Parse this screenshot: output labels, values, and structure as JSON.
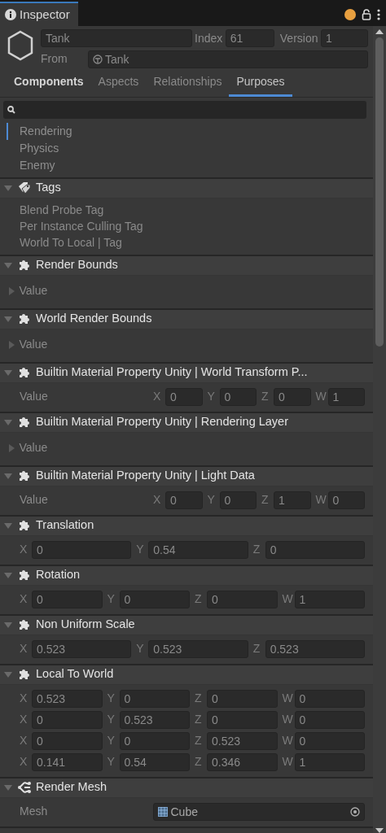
{
  "window": {
    "title": "Inspector"
  },
  "entity": {
    "name": "Tank",
    "index_label": "Index",
    "index": "61",
    "version_label": "Version",
    "version": "1",
    "from_label": "From",
    "from": "Tank"
  },
  "tabs": [
    {
      "label": "Components",
      "selected": false
    },
    {
      "label": "Aspects",
      "selected": false
    },
    {
      "label": "Relationships",
      "selected": false
    },
    {
      "label": "Purposes",
      "selected": true
    }
  ],
  "purposes": [
    {
      "label": "Rendering",
      "selected": true
    },
    {
      "label": "Physics",
      "selected": false
    },
    {
      "label": "Enemy",
      "selected": false
    }
  ],
  "components": [
    {
      "kind": "tags",
      "title": "Tags",
      "expanded": true,
      "items": [
        "Blend Probe Tag",
        "Per Instance Culling Tag",
        "World To Local | Tag"
      ]
    },
    {
      "kind": "foldout",
      "title": "Render Bounds",
      "expanded": true,
      "field": {
        "label": "Value",
        "expanded": false
      }
    },
    {
      "kind": "foldout",
      "title": "World Render Bounds",
      "expanded": true,
      "field": {
        "label": "Value",
        "expanded": false
      }
    },
    {
      "kind": "vector",
      "title": "Builtin Material Property Unity | World Transform P...",
      "expanded": true,
      "rows": [
        {
          "label": "Value",
          "fields": [
            {
              "axis": "X",
              "value": "0"
            },
            {
              "axis": "Y",
              "value": "0"
            },
            {
              "axis": "Z",
              "value": "0"
            },
            {
              "axis": "W",
              "value": "1"
            }
          ]
        }
      ]
    },
    {
      "kind": "foldout",
      "title": "Builtin Material Property Unity | Rendering Layer",
      "expanded": true,
      "field": {
        "label": "Value",
        "expanded": false
      }
    },
    {
      "kind": "vector",
      "title": "Builtin Material Property Unity | Light Data",
      "expanded": true,
      "rows": [
        {
          "label": "Value",
          "fields": [
            {
              "axis": "X",
              "value": "0"
            },
            {
              "axis": "Y",
              "value": "0"
            },
            {
              "axis": "Z",
              "value": "1"
            },
            {
              "axis": "W",
              "value": "0"
            }
          ]
        }
      ]
    },
    {
      "kind": "vector",
      "title": "Translation",
      "expanded": true,
      "rows": [
        {
          "fields": [
            {
              "axis": "X",
              "value": "0"
            },
            {
              "axis": "Y",
              "value": "0.54"
            },
            {
              "axis": "Z",
              "value": "0"
            }
          ]
        }
      ]
    },
    {
      "kind": "vector",
      "title": "Rotation",
      "expanded": true,
      "rows": [
        {
          "fields": [
            {
              "axis": "X",
              "value": "0"
            },
            {
              "axis": "Y",
              "value": "0"
            },
            {
              "axis": "Z",
              "value": "0"
            },
            {
              "axis": "W",
              "value": "1"
            }
          ]
        }
      ]
    },
    {
      "kind": "vector",
      "title": "Non Uniform Scale",
      "expanded": true,
      "rows": [
        {
          "fields": [
            {
              "axis": "X",
              "value": "0.523"
            },
            {
              "axis": "Y",
              "value": "0.523"
            },
            {
              "axis": "Z",
              "value": "0.523"
            }
          ]
        }
      ]
    },
    {
      "kind": "vector",
      "title": "Local To World",
      "expanded": true,
      "rows": [
        {
          "fields": [
            {
              "axis": "X",
              "value": "0.523"
            },
            {
              "axis": "Y",
              "value": "0"
            },
            {
              "axis": "Z",
              "value": "0"
            },
            {
              "axis": "W",
              "value": "0"
            }
          ]
        },
        {
          "fields": [
            {
              "axis": "X",
              "value": "0"
            },
            {
              "axis": "Y",
              "value": "0.523"
            },
            {
              "axis": "Z",
              "value": "0"
            },
            {
              "axis": "W",
              "value": "0"
            }
          ]
        },
        {
          "fields": [
            {
              "axis": "X",
              "value": "0"
            },
            {
              "axis": "Y",
              "value": "0"
            },
            {
              "axis": "Z",
              "value": "0.523"
            },
            {
              "axis": "W",
              "value": "0"
            }
          ]
        },
        {
          "fields": [
            {
              "axis": "X",
              "value": "0.141"
            },
            {
              "axis": "Y",
              "value": "0.54"
            },
            {
              "axis": "Z",
              "value": "0.346"
            },
            {
              "axis": "W",
              "value": "1"
            }
          ]
        }
      ]
    },
    {
      "kind": "object",
      "title": "Render Mesh",
      "expanded": true,
      "label": "Mesh",
      "value": "Cube"
    }
  ]
}
